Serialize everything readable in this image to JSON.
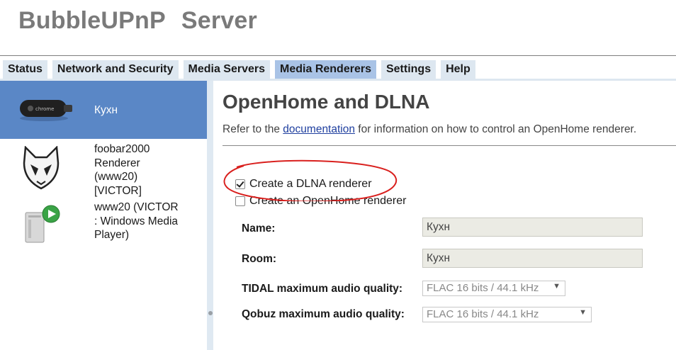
{
  "app": {
    "title_part1": "BubbleUPnP",
    "title_part2": "Server"
  },
  "tabs": [
    {
      "label": "Status"
    },
    {
      "label": "Network and Security"
    },
    {
      "label": "Media Servers"
    },
    {
      "label": "Media Renderers",
      "active": true
    },
    {
      "label": "Settings"
    },
    {
      "label": "Help"
    }
  ],
  "sidebar": {
    "renderers": [
      {
        "label": "Кухн",
        "icon": "chromecast-icon",
        "selected": true
      },
      {
        "label": "foobar2000\nRenderer\n(www20)\n[VICTOR]",
        "icon": "foobar2000-alien-icon"
      },
      {
        "label": "www20 (VICTOR\n: Windows Media\nPlayer)",
        "icon": "windows-media-player-icon"
      }
    ]
  },
  "main": {
    "title": "OpenHome and DLNA",
    "intro_before": "Refer to the ",
    "intro_link": "documentation",
    "intro_after": " for information on how to control an OpenHome renderer.",
    "create_dlna_label": "Create a DLNA renderer",
    "create_dlna_checked": true,
    "create_openhome_label": "Create an OpenHome renderer",
    "create_openhome_checked": false,
    "name_label": "Name:",
    "name_value": "Кухн",
    "room_label": "Room:",
    "room_value": "Кухн",
    "tidal_label": "TIDAL maximum audio quality:",
    "tidal_value": "FLAC 16 bits / 44.1 kHz",
    "qobuz_label": "Qobuz maximum audio quality:",
    "qobuz_value": "FLAC 16 bits / 44.1 kHz"
  },
  "colors": {
    "accent_selected": "#5a87c6",
    "tab_active": "#a9c3e6",
    "tab_inactive": "#dde7f0",
    "annotation_red": "#d9201e"
  }
}
